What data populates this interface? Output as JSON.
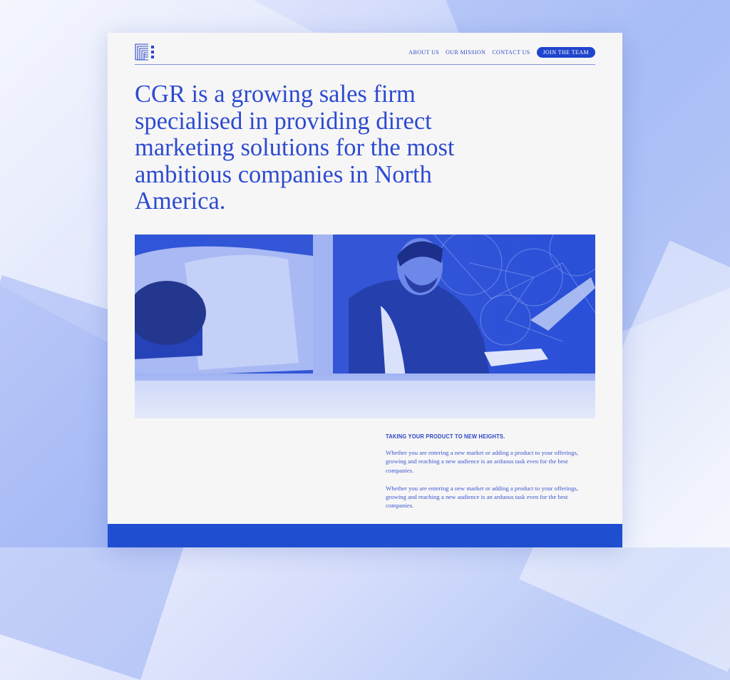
{
  "nav": {
    "about": "ABOUT US",
    "mission": "OUR MISSION",
    "contact": "CONTACT US",
    "join": "JOIN THE TEAM"
  },
  "hero": {
    "heading": "CGR is a growing sales firm specialised in providing direct marketing solutions for the most ambitious companies in North America."
  },
  "section": {
    "title": "TAKING YOUR PRODUCT TO NEW HEIGHTS.",
    "paragraphs": [
      "Whether you are entering a new market or adding a product to your offerings, growing and reaching a new audience is an arduous task even for the best companies.",
      "Whether you are entering a new market or adding a product to your offerings, growing and reaching a new audience is an arduous task even for the best companies."
    ]
  },
  "colors": {
    "accent": "#1f45cc",
    "text": "#2c4bd0",
    "page": "#f7f6f6"
  },
  "icons": {
    "logo": "cgr-stacked-bars-logo",
    "photo": "team-meeting-photo"
  }
}
